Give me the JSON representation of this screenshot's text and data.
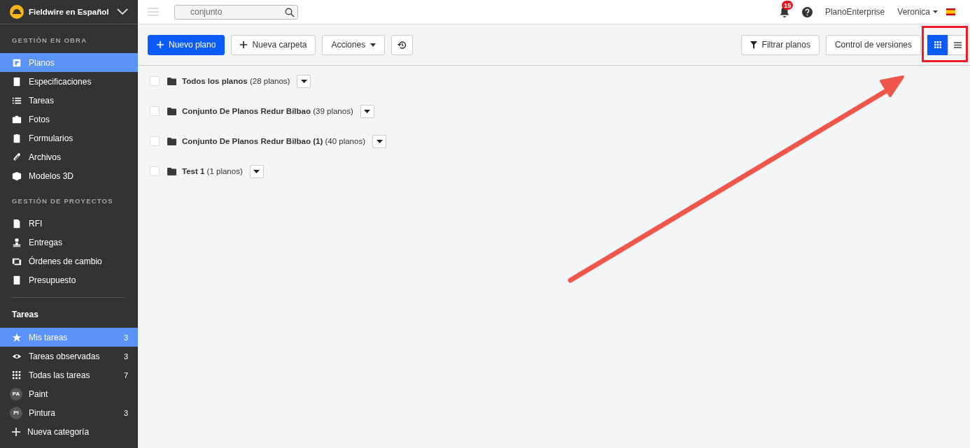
{
  "workspace": {
    "name": "Fieldwire en Español"
  },
  "sections": [
    {
      "title": "GESTIÓN EN OBRA",
      "items": [
        {
          "label": "Planos",
          "selected": true
        },
        {
          "label": "Especificaciones",
          "selected": false
        },
        {
          "label": "Tareas",
          "selected": false
        },
        {
          "label": "Fotos",
          "selected": false
        },
        {
          "label": "Formularios",
          "selected": false
        },
        {
          "label": "Archivos",
          "selected": false
        },
        {
          "label": "Modelos 3D",
          "selected": false
        }
      ]
    },
    {
      "title": "GESTIÓN DE PROYECTOS",
      "items": [
        {
          "label": "RFI",
          "selected": false
        },
        {
          "label": "Entregas",
          "selected": false
        },
        {
          "label": "Órdenes de cambio",
          "selected": false
        },
        {
          "label": "Presupuesto",
          "selected": false
        }
      ]
    }
  ],
  "tasks": {
    "title": "Tareas",
    "items": [
      {
        "kind": "icon",
        "label": "Mis tareas",
        "count": "3",
        "selected": true
      },
      {
        "kind": "icon",
        "label": "Tareas observadas",
        "count": "3",
        "selected": false
      },
      {
        "kind": "icon",
        "label": "Todas las tareas",
        "count": "7",
        "selected": false
      },
      {
        "kind": "avatar",
        "avatar": "PA",
        "label": "Paint",
        "selected": false
      },
      {
        "kind": "avatar",
        "avatar": "PI",
        "label": "Pintura",
        "count": "3",
        "selected": false
      },
      {
        "kind": "add",
        "label": "Nueva categoría",
        "selected": false
      }
    ]
  },
  "topbar": {
    "search": {
      "value": "conjunto"
    },
    "notifications": "15",
    "plan": "PlanoEnterprise",
    "user": "Veronica"
  },
  "toolbar": {
    "new_plan": "Nuevo plano",
    "new_folder": "Nueva carpeta",
    "actions": "Acciones",
    "filter": "Filtrar planos",
    "versions": "Control de versiones",
    "views": [
      {
        "kind": "grid",
        "selected": true
      },
      {
        "kind": "list",
        "selected": false
      }
    ]
  },
  "folders": [
    {
      "name": "Todos los planos",
      "count": "(28 planos)",
      "checked": false
    },
    {
      "name": "Conjunto De Planos Redur Bilbao",
      "count": "(39 planos)",
      "checked": false
    },
    {
      "name": "Conjunto De Planos Redur Bilbao (1)",
      "count": "(40 planos)",
      "checked": false
    },
    {
      "name": "Test 1",
      "count": "(1 planos)",
      "checked": false
    }
  ]
}
